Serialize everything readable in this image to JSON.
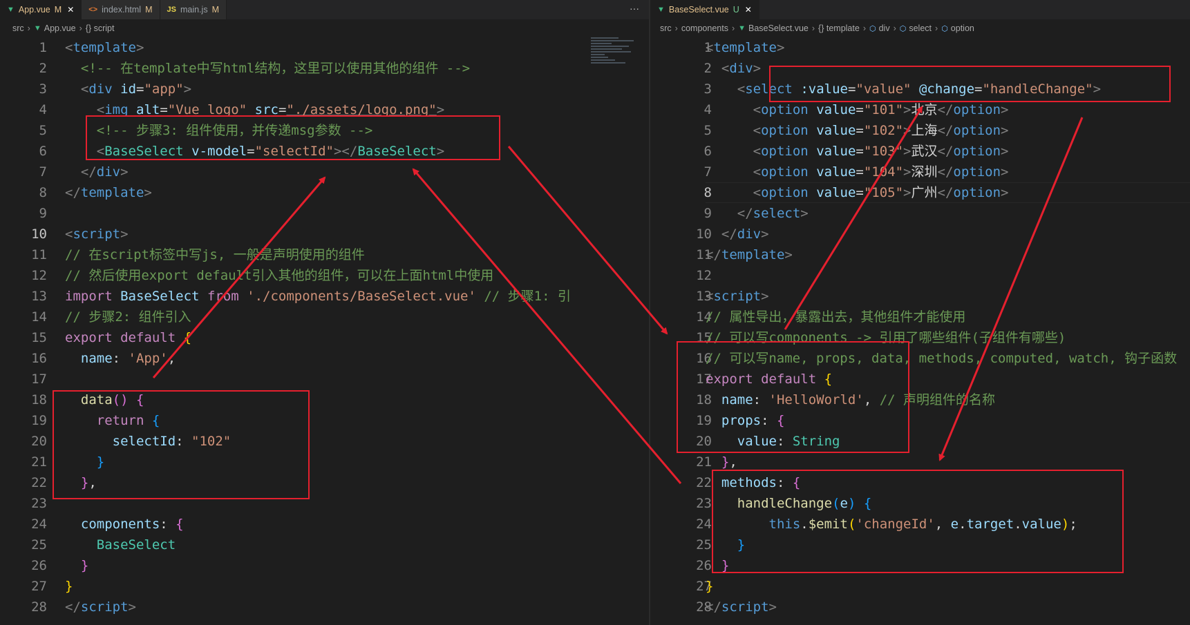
{
  "left": {
    "tabs": [
      {
        "label": "App.vue",
        "mark": "M",
        "icon": "vue-icon",
        "active": true
      },
      {
        "label": "index.html",
        "mark": "M",
        "icon": "html-icon",
        "active": false
      },
      {
        "label": "main.js",
        "mark": "M",
        "icon": "js-icon",
        "active": false
      }
    ],
    "more_label": "···",
    "breadcrumb": [
      "src",
      "App.vue",
      "{} script"
    ],
    "current_line": 10,
    "lines": [
      [
        [
          "c-br",
          "<"
        ],
        [
          "c-tag",
          "template"
        ],
        [
          "c-br",
          ">"
        ]
      ],
      [
        [
          "c-txt",
          "  "
        ],
        [
          "c-com",
          "<!-- 在template中写html结构，这里可以使用其他的组件 -->"
        ]
      ],
      [
        [
          "c-txt",
          "  "
        ],
        [
          "c-br",
          "<"
        ],
        [
          "c-tag",
          "div"
        ],
        [
          "c-txt",
          " "
        ],
        [
          "c-attr",
          "id"
        ],
        [
          "c-txt",
          "="
        ],
        [
          "c-str",
          "\"app\""
        ],
        [
          "c-br",
          ">"
        ]
      ],
      [
        [
          "c-txt",
          "    "
        ],
        [
          "c-br",
          "<"
        ],
        [
          "c-tag",
          "img"
        ],
        [
          "c-txt",
          " "
        ],
        [
          "c-attr",
          "alt"
        ],
        [
          "c-txt",
          "="
        ],
        [
          "c-str",
          "\"Vue logo\""
        ],
        [
          "c-txt",
          " "
        ],
        [
          "c-attr",
          "src"
        ],
        [
          "c-txt",
          "="
        ],
        [
          "c-str c-u",
          "\"./assets/logo.png\""
        ],
        [
          "c-br",
          ">"
        ]
      ],
      [
        [
          "c-txt",
          "    "
        ],
        [
          "c-com",
          "<!-- 步骤3: 组件使用，并传递msg参数 -->"
        ]
      ],
      [
        [
          "c-txt",
          "    "
        ],
        [
          "c-br",
          "<"
        ],
        [
          "c-comp",
          "BaseSelect"
        ],
        [
          "c-txt",
          " "
        ],
        [
          "c-attr",
          "v-model"
        ],
        [
          "c-txt",
          "="
        ],
        [
          "c-str",
          "\"selectId\""
        ],
        [
          "c-br",
          "></"
        ],
        [
          "c-comp",
          "BaseSelect"
        ],
        [
          "c-br",
          ">"
        ]
      ],
      [
        [
          "c-txt",
          "  "
        ],
        [
          "c-br",
          "</"
        ],
        [
          "c-tag",
          "div"
        ],
        [
          "c-br",
          ">"
        ]
      ],
      [
        [
          "c-br",
          "</"
        ],
        [
          "c-tag",
          "template"
        ],
        [
          "c-br",
          ">"
        ]
      ],
      [],
      [
        [
          "c-br",
          "<"
        ],
        [
          "c-tag",
          "script"
        ],
        [
          "c-br",
          ">"
        ]
      ],
      [
        [
          "c-com",
          "// 在script标签中写js, 一般是声明使用的组件"
        ]
      ],
      [
        [
          "c-com",
          "// 然后使用export default引入其他的组件，可以在上面html中使用"
        ]
      ],
      [
        [
          "c-kw",
          "import"
        ],
        [
          "c-txt",
          " "
        ],
        [
          "c-var",
          "BaseSelect"
        ],
        [
          "c-txt",
          " "
        ],
        [
          "c-kw",
          "from"
        ],
        [
          "c-txt",
          " "
        ],
        [
          "c-str",
          "'./components/BaseSelect.vue'"
        ],
        [
          "c-txt",
          " "
        ],
        [
          "c-com",
          "// 步骤1: 引"
        ]
      ],
      [
        [
          "c-com",
          "// 步骤2: 组件引入"
        ]
      ],
      [
        [
          "c-kw",
          "export"
        ],
        [
          "c-txt",
          " "
        ],
        [
          "c-kw",
          "default"
        ],
        [
          "c-txt",
          " "
        ],
        [
          "c-br1",
          "{"
        ]
      ],
      [
        [
          "c-txt",
          "  "
        ],
        [
          "c-var",
          "name"
        ],
        [
          "c-txt",
          ": "
        ],
        [
          "c-str",
          "'App'"
        ],
        [
          "c-txt",
          ","
        ]
      ],
      [],
      [
        [
          "c-txt",
          "  "
        ],
        [
          "c-fn",
          "data"
        ],
        [
          "c-br2",
          "()"
        ],
        [
          "c-txt",
          " "
        ],
        [
          "c-br2",
          "{"
        ]
      ],
      [
        [
          "c-txt",
          "    "
        ],
        [
          "c-kw",
          "return"
        ],
        [
          "c-txt",
          " "
        ],
        [
          "c-br3",
          "{"
        ]
      ],
      [
        [
          "c-txt",
          "      "
        ],
        [
          "c-var",
          "selectId"
        ],
        [
          "c-txt",
          ": "
        ],
        [
          "c-str",
          "\"102\""
        ]
      ],
      [
        [
          "c-txt",
          "    "
        ],
        [
          "c-br3",
          "}"
        ]
      ],
      [
        [
          "c-txt",
          "  "
        ],
        [
          "c-br2",
          "}"
        ],
        [
          "c-txt",
          ","
        ]
      ],
      [],
      [
        [
          "c-txt",
          "  "
        ],
        [
          "c-var",
          "components"
        ],
        [
          "c-txt",
          ": "
        ],
        [
          "c-br2",
          "{"
        ]
      ],
      [
        [
          "c-txt",
          "    "
        ],
        [
          "c-cls",
          "BaseSelect"
        ]
      ],
      [
        [
          "c-txt",
          "  "
        ],
        [
          "c-br2",
          "}"
        ]
      ],
      [
        [
          "c-br1",
          "}"
        ]
      ],
      [
        [
          "c-br",
          "</"
        ],
        [
          "c-tag",
          "script"
        ],
        [
          "c-br",
          ">"
        ]
      ]
    ]
  },
  "right": {
    "tabs": [
      {
        "label": "BaseSelect.vue",
        "mark": "U",
        "icon": "vue-icon",
        "active": true
      }
    ],
    "breadcrumb": [
      "src",
      "components",
      "BaseSelect.vue",
      "{} template",
      "div",
      "select",
      "option"
    ],
    "current_line": 8,
    "lines": [
      [
        [
          "c-br",
          "<"
        ],
        [
          "c-tag",
          "template"
        ],
        [
          "c-br",
          ">"
        ]
      ],
      [
        [
          "c-txt",
          "  "
        ],
        [
          "c-br",
          "<"
        ],
        [
          "c-tag",
          "div"
        ],
        [
          "c-br",
          ">"
        ]
      ],
      [
        [
          "c-txt",
          "    "
        ],
        [
          "c-br",
          "<"
        ],
        [
          "c-tag",
          "select"
        ],
        [
          "c-txt",
          " "
        ],
        [
          "c-attr",
          ":value"
        ],
        [
          "c-txt",
          "="
        ],
        [
          "c-str",
          "\"value\""
        ],
        [
          "c-txt",
          " "
        ],
        [
          "c-attr",
          "@change"
        ],
        [
          "c-txt",
          "="
        ],
        [
          "c-str",
          "\"handleChange\""
        ],
        [
          "c-br",
          ">"
        ]
      ],
      [
        [
          "c-txt",
          "      "
        ],
        [
          "c-br",
          "<"
        ],
        [
          "c-tag",
          "option"
        ],
        [
          "c-txt",
          " "
        ],
        [
          "c-attr",
          "value"
        ],
        [
          "c-txt",
          "="
        ],
        [
          "c-str",
          "\"101\""
        ],
        [
          "c-br",
          ">"
        ],
        [
          "c-txt",
          "北京"
        ],
        [
          "c-br",
          "</"
        ],
        [
          "c-tag",
          "option"
        ],
        [
          "c-br",
          ">"
        ]
      ],
      [
        [
          "c-txt",
          "      "
        ],
        [
          "c-br",
          "<"
        ],
        [
          "c-tag",
          "option"
        ],
        [
          "c-txt",
          " "
        ],
        [
          "c-attr",
          "value"
        ],
        [
          "c-txt",
          "="
        ],
        [
          "c-str",
          "\"102\""
        ],
        [
          "c-br",
          ">"
        ],
        [
          "c-txt",
          "上海"
        ],
        [
          "c-br",
          "</"
        ],
        [
          "c-tag",
          "option"
        ],
        [
          "c-br",
          ">"
        ]
      ],
      [
        [
          "c-txt",
          "      "
        ],
        [
          "c-br",
          "<"
        ],
        [
          "c-tag",
          "option"
        ],
        [
          "c-txt",
          " "
        ],
        [
          "c-attr",
          "value"
        ],
        [
          "c-txt",
          "="
        ],
        [
          "c-str",
          "\"103\""
        ],
        [
          "c-br",
          ">"
        ],
        [
          "c-txt",
          "武汉"
        ],
        [
          "c-br",
          "</"
        ],
        [
          "c-tag",
          "option"
        ],
        [
          "c-br",
          ">"
        ]
      ],
      [
        [
          "c-txt",
          "      "
        ],
        [
          "c-br",
          "<"
        ],
        [
          "c-tag",
          "option"
        ],
        [
          "c-txt",
          " "
        ],
        [
          "c-attr",
          "value"
        ],
        [
          "c-txt",
          "="
        ],
        [
          "c-str",
          "\"104\""
        ],
        [
          "c-br",
          ">"
        ],
        [
          "c-txt",
          "深圳"
        ],
        [
          "c-br",
          "</"
        ],
        [
          "c-tag",
          "option"
        ],
        [
          "c-br",
          ">"
        ]
      ],
      [
        [
          "c-txt",
          "      "
        ],
        [
          "c-br",
          "<"
        ],
        [
          "c-tag",
          "option"
        ],
        [
          "c-txt",
          " "
        ],
        [
          "c-attr",
          "value"
        ],
        [
          "c-txt",
          "="
        ],
        [
          "c-str",
          "\"105\""
        ],
        [
          "c-br",
          ">"
        ],
        [
          "c-txt",
          "广州"
        ],
        [
          "c-br",
          "</"
        ],
        [
          "c-tag",
          "option"
        ],
        [
          "c-br",
          ">"
        ]
      ],
      [
        [
          "c-txt",
          "    "
        ],
        [
          "c-br",
          "</"
        ],
        [
          "c-tag",
          "select"
        ],
        [
          "c-br",
          ">"
        ]
      ],
      [
        [
          "c-txt",
          "  "
        ],
        [
          "c-br",
          "</"
        ],
        [
          "c-tag",
          "div"
        ],
        [
          "c-br",
          ">"
        ]
      ],
      [
        [
          "c-br",
          "</"
        ],
        [
          "c-tag",
          "template"
        ],
        [
          "c-br",
          ">"
        ]
      ],
      [],
      [
        [
          "c-br",
          "<"
        ],
        [
          "c-tag",
          "script"
        ],
        [
          "c-br",
          ">"
        ]
      ],
      [
        [
          "c-com",
          "// 属性导出，暴露出去，其他组件才能使用"
        ]
      ],
      [
        [
          "c-com",
          "// 可以写components -> 引用了哪些组件(子组件有哪些)"
        ]
      ],
      [
        [
          "c-com",
          "// 可以写name, props, data, methods, computed, watch, 钩子函数"
        ]
      ],
      [
        [
          "c-kw",
          "export"
        ],
        [
          "c-txt",
          " "
        ],
        [
          "c-kw",
          "default"
        ],
        [
          "c-txt",
          " "
        ],
        [
          "c-br1",
          "{"
        ]
      ],
      [
        [
          "c-txt",
          "  "
        ],
        [
          "c-var",
          "name"
        ],
        [
          "c-txt",
          ": "
        ],
        [
          "c-str",
          "'HelloWorld'"
        ],
        [
          "c-txt",
          ", "
        ],
        [
          "c-com",
          "// 声明组件的名称"
        ]
      ],
      [
        [
          "c-txt",
          "  "
        ],
        [
          "c-var",
          "props"
        ],
        [
          "c-txt",
          ": "
        ],
        [
          "c-br2",
          "{"
        ]
      ],
      [
        [
          "c-txt",
          "    "
        ],
        [
          "c-var",
          "value"
        ],
        [
          "c-txt",
          ": "
        ],
        [
          "c-cls",
          "String"
        ]
      ],
      [
        [
          "c-txt",
          "  "
        ],
        [
          "c-br2",
          "}"
        ],
        [
          "c-txt",
          ","
        ]
      ],
      [
        [
          "c-txt",
          "  "
        ],
        [
          "c-var",
          "methods"
        ],
        [
          "c-txt",
          ": "
        ],
        [
          "c-br2",
          "{"
        ]
      ],
      [
        [
          "c-txt",
          "    "
        ],
        [
          "c-fn",
          "handleChange"
        ],
        [
          "c-br3",
          "("
        ],
        [
          "c-var",
          "e"
        ],
        [
          "c-br3",
          ")"
        ],
        [
          "c-txt",
          " "
        ],
        [
          "c-br3",
          "{"
        ]
      ],
      [
        [
          "c-txt",
          "        "
        ],
        [
          "c-kw2",
          "this"
        ],
        [
          "c-txt",
          "."
        ],
        [
          "c-fn",
          "$emit"
        ],
        [
          "c-br1",
          "("
        ],
        [
          "c-str",
          "'changeId'"
        ],
        [
          "c-txt",
          ", "
        ],
        [
          "c-var",
          "e"
        ],
        [
          "c-txt",
          "."
        ],
        [
          "c-var",
          "target"
        ],
        [
          "c-txt",
          "."
        ],
        [
          "c-var",
          "value"
        ],
        [
          "c-br1",
          ")"
        ],
        [
          "c-txt",
          ";"
        ]
      ],
      [
        [
          "c-txt",
          "    "
        ],
        [
          "c-br3",
          "}"
        ]
      ],
      [
        [
          "c-txt",
          "  "
        ],
        [
          "c-br2",
          "}"
        ]
      ],
      [
        [
          "c-br1",
          "}"
        ]
      ],
      [
        [
          "c-br",
          "</"
        ],
        [
          "c-tag",
          "script"
        ],
        [
          "c-br",
          ">"
        ]
      ]
    ]
  }
}
